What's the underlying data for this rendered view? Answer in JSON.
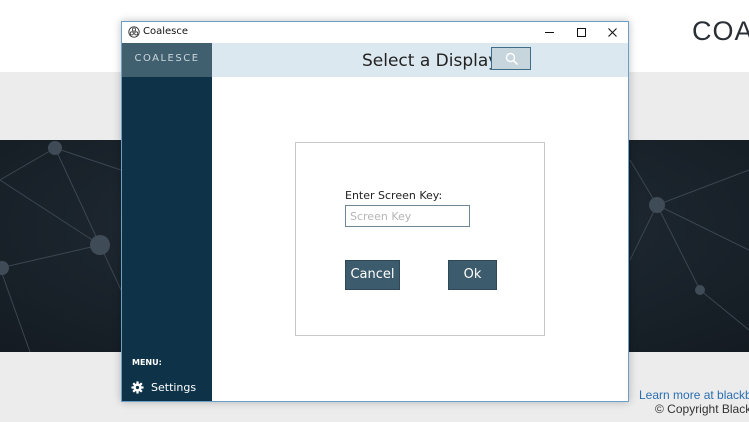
{
  "background_page": {
    "logo_text": "COA",
    "footer_link": "Learn more at blackbc",
    "footer_copyright": "© Copyright Black"
  },
  "window": {
    "title": "Coalesce",
    "controls": {
      "minimize_icon": "minimize-icon",
      "maximize_icon": "maximize-icon",
      "close_icon": "close-icon"
    }
  },
  "sidebar": {
    "brand": "COALESCE",
    "menu_label": "MENU:",
    "items": [
      {
        "label": "Settings",
        "icon": "gear-icon"
      }
    ]
  },
  "header": {
    "title": "Select a Display",
    "search_icon": "search-icon"
  },
  "dialog": {
    "field_label": "Enter Screen Key:",
    "field_value": "",
    "field_placeholder": "Screen Key",
    "cancel_label": "Cancel",
    "ok_label": "Ok"
  },
  "colors": {
    "sidebar": "#0e3349",
    "brand_bar": "#41606f",
    "header_bar": "#dbe8ef",
    "button": "#3c5b6c",
    "hero": "#1a232b"
  }
}
